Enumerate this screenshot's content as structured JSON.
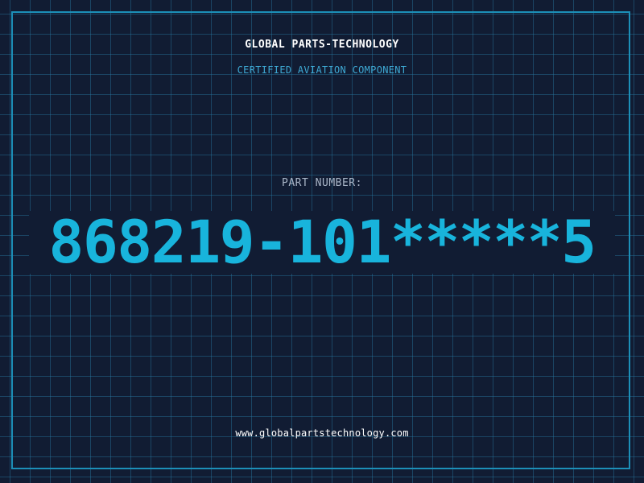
{
  "header": {
    "company": "GLOBAL PARTS-TECHNOLOGY",
    "subtitle": "CERTIFIED AVIATION COMPONENT"
  },
  "part": {
    "label": "PART NUMBER:",
    "number": "868219-101*****5"
  },
  "footer": {
    "website": "www.globalpartstechnology.com"
  },
  "colors": {
    "background": "#111c33",
    "grid": "#1f5f80",
    "frame": "#1c8fb8",
    "accent": "#18b4dc",
    "subtitle": "#3ea9d4",
    "label": "#aab6c8",
    "text": "#ffffff"
  }
}
